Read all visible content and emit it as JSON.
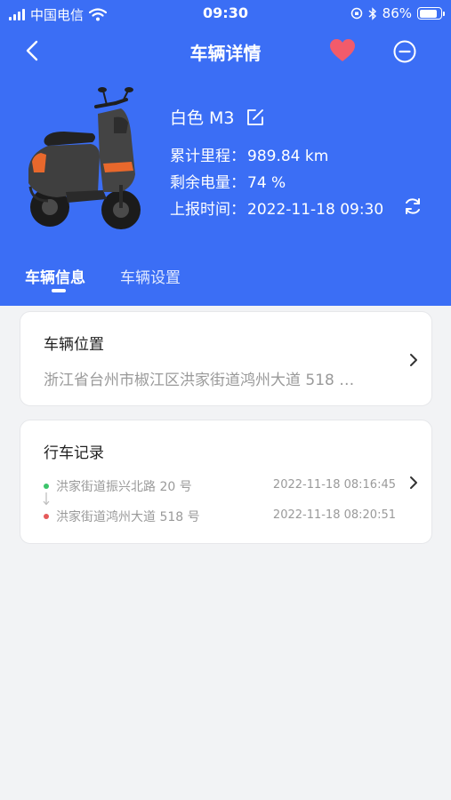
{
  "status_bar": {
    "carrier": "中国电信",
    "time": "09:30",
    "battery": "86%",
    "battery_level": 0.86
  },
  "nav": {
    "title": "车辆详情",
    "back_icon": "chevron-left-icon",
    "favorite_icon": "heart-icon",
    "more_icon": "minus-circle-icon",
    "favorite_color": "#f25b6b"
  },
  "vehicle": {
    "name": "白色 M3",
    "mileage_label": "累计里程：",
    "mileage_value": "989.84 km",
    "battery_label": "剩余电量：",
    "battery_value": "74 %",
    "report_label": "上报时间：",
    "report_value": "2022-11-18 09:30"
  },
  "tabs": [
    {
      "label": "车辆信息",
      "active": true
    },
    {
      "label": "车辆设置",
      "active": false
    }
  ],
  "location_card": {
    "title": "车辆位置",
    "address": "浙江省台州市椒江区洪家街道鸿州大道 518 …"
  },
  "trips_card": {
    "title": "行车记录",
    "start_address": "洪家街道振兴北路 20 号",
    "start_time": "2022-11-18 08:16:45",
    "end_address": "洪家街道鸿州大道 518 号",
    "end_time": "2022-11-18 08:20:51",
    "start_color": "#3cc46b",
    "end_color": "#e55a5a"
  },
  "colors": {
    "header_bg": "#3b6ef5",
    "page_bg": "#f2f3f5"
  }
}
